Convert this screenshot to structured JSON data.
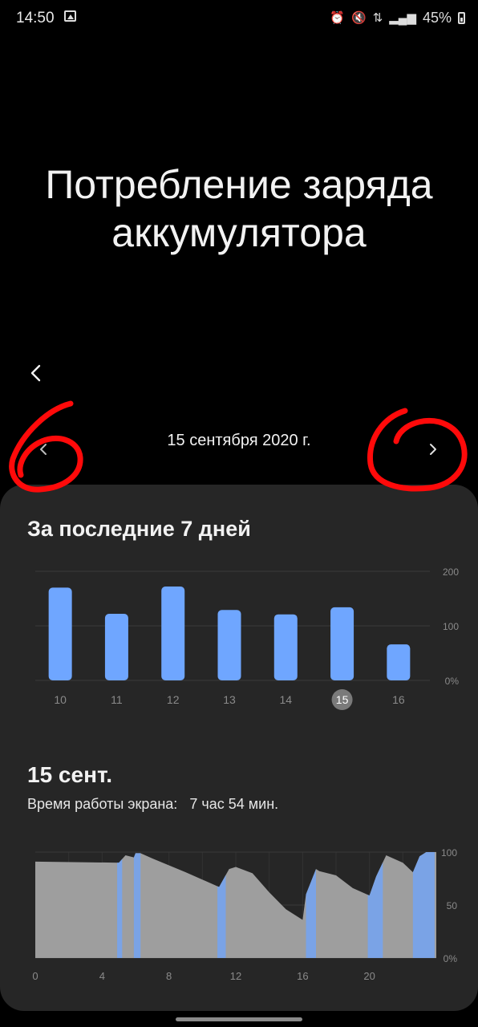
{
  "status_bar": {
    "time": "14:50",
    "battery_percent": "45%",
    "icons": [
      "gallery-icon",
      "alarm-icon",
      "mute-icon",
      "data-arrows-icon",
      "signal-icon",
      "battery-icon"
    ]
  },
  "page": {
    "title_line1": "Потребление заряда",
    "title_line2": "аккумулятора",
    "date": "15 сентября 2020 г."
  },
  "week_section": {
    "title": "За последние 7 дней"
  },
  "day_section": {
    "title": "15 сент.",
    "screen_time_label": "Время работы экрана:",
    "screen_time_value": "7 час 54 мин."
  },
  "colors": {
    "background": "#000000",
    "card": "#262626",
    "bar_blue": "#6fa6ff",
    "area_gray": "#9e9e9e",
    "area_blue": "#7aa3e6",
    "annotation_red": "#ff0a0a"
  },
  "chart_data": [
    {
      "type": "bar",
      "categories": [
        "10",
        "11",
        "12",
        "13",
        "14",
        "15",
        "16"
      ],
      "values": [
        170,
        122,
        172,
        129,
        121,
        134,
        66
      ],
      "selected_category": "15",
      "y_ticks": [
        "0%",
        "100",
        "200"
      ],
      "ylim": [
        0,
        200
      ],
      "grid": true
    },
    {
      "type": "area",
      "x_ticks": [
        "0",
        "4",
        "8",
        "12",
        "16",
        "20"
      ],
      "y_ticks": [
        "0%",
        "50",
        "100"
      ],
      "xlim": [
        0,
        24
      ],
      "ylim": [
        0,
        100
      ],
      "series": [
        {
          "x": [
            0,
            5.0,
            5.4,
            5.9,
            6.0,
            6.3,
            7.0,
            9.0,
            11.0,
            11.6,
            12.0,
            13.0,
            14.0,
            15.0,
            16.0,
            16.2,
            16.8,
            17.0,
            18.0,
            19.0,
            20.0,
            20.4,
            21.0,
            22.0,
            22.6,
            23.0,
            23.4,
            24.0
          ],
          "values": [
            91,
            90,
            97,
            95,
            99,
            99,
            94,
            81,
            67,
            84,
            86,
            80,
            62,
            46,
            36,
            60,
            84,
            82,
            78,
            66,
            59,
            77,
            97,
            90,
            81,
            96,
            100,
            100
          ]
        }
      ],
      "charging_periods": [
        [
          4.9,
          5.2
        ],
        [
          5.9,
          6.3
        ],
        [
          10.9,
          11.4
        ],
        [
          16.2,
          16.8
        ],
        [
          19.9,
          20.8
        ],
        [
          22.6,
          23.9
        ]
      ]
    }
  ]
}
